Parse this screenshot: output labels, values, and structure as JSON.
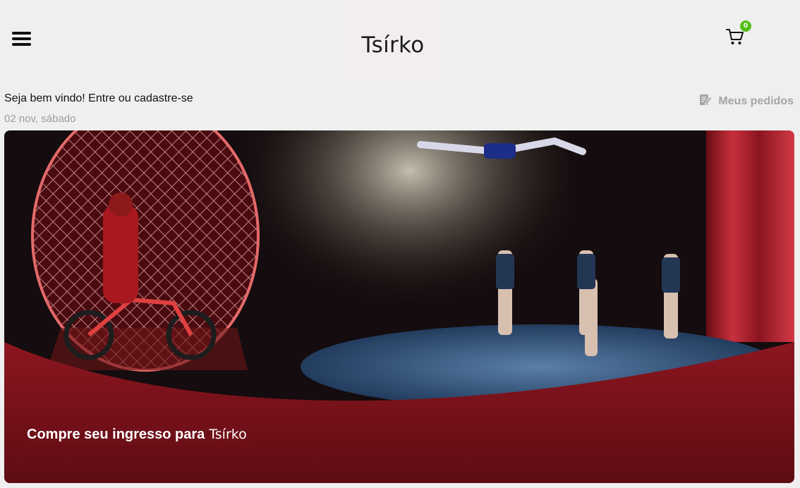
{
  "header": {
    "logo": "Tsírko",
    "cart_count": "0"
  },
  "user": {
    "welcome": "Seja bem vindo! Entre ou cadastre-se",
    "date": "02 nov, sábado"
  },
  "orders": {
    "label": "Meus pedidos"
  },
  "hero": {
    "title": "Compre seu ingresso para",
    "name": "Tsírko"
  },
  "colors": {
    "badge": "#55bf1a",
    "banner_red": "#7b1018",
    "muted_text": "#9b9b9b"
  },
  "icons": {
    "menu": "hamburger-menu-icon",
    "cart": "shopping-cart-icon",
    "orders": "edit-document-icon"
  }
}
